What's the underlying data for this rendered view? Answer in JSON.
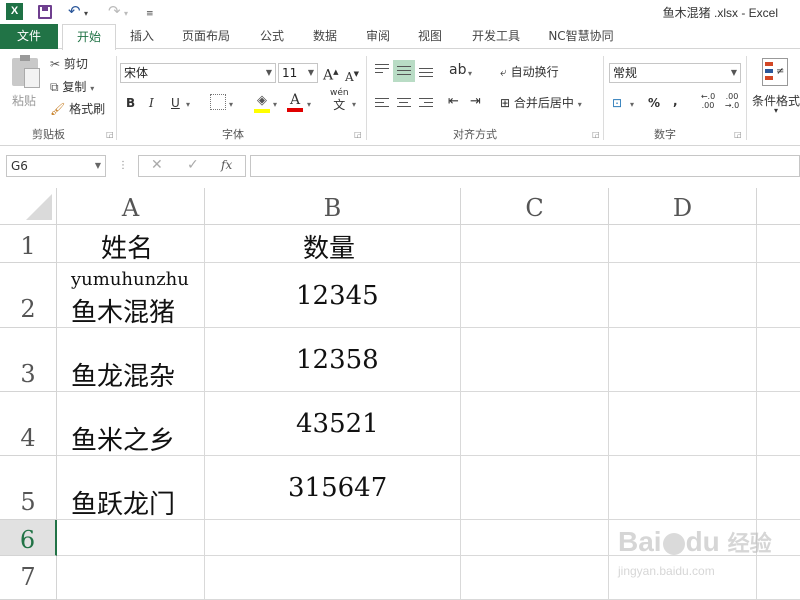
{
  "window": {
    "title": "鱼木混猪 .xlsx - Excel"
  },
  "ribbon": {
    "tabs": [
      "文件",
      "开始",
      "插入",
      "页面布局",
      "公式",
      "数据",
      "审阅",
      "视图",
      "开发工具",
      "NC智慧协同"
    ],
    "active_tab": "开始",
    "clipboard": {
      "paste": "粘贴",
      "cut": "剪切",
      "copy": "复制",
      "format_painter": "格式刷",
      "group": "剪贴板"
    },
    "font": {
      "name": "宋体",
      "size": "11",
      "group": "字体",
      "bold": "B",
      "italic": "I",
      "underline": "U",
      "wen": "wén",
      "wen_char": "文"
    },
    "alignment": {
      "wrap": "自动换行",
      "merge": "合并后居中",
      "group": "对齐方式"
    },
    "number": {
      "format": "常规",
      "percent": "%",
      "comma": ",",
      "inc": "←.0 .00",
      "dec": ".00 →.0",
      "group": "数字"
    },
    "styles": {
      "conditional": "条件格式"
    }
  },
  "formula_bar": {
    "name_box": "G6",
    "fx": "fx",
    "value": ""
  },
  "columns": [
    "A",
    "B",
    "C",
    "D"
  ],
  "rows": [
    {
      "num": "1",
      "a": "姓名",
      "b": "数量",
      "phonetic": ""
    },
    {
      "num": "2",
      "a": "鱼木混猪",
      "b": "12345",
      "phonetic": "yumuhunzhu"
    },
    {
      "num": "3",
      "a": "鱼龙混杂",
      "b": "12358",
      "phonetic": ""
    },
    {
      "num": "4",
      "a": "鱼米之乡",
      "b": "43521",
      "phonetic": ""
    },
    {
      "num": "5",
      "a": "鱼跃龙门",
      "b": "315647",
      "phonetic": ""
    },
    {
      "num": "6",
      "a": "",
      "b": "",
      "phonetic": ""
    },
    {
      "num": "7",
      "a": "",
      "b": "",
      "phonetic": ""
    }
  ],
  "selected_cell": "G6",
  "watermark": {
    "brand": "Bai",
    "brand2": "du",
    "jingyan": "经验",
    "url": "jingyan.baidu.com"
  },
  "colors": {
    "excel_green": "#217346",
    "selected_row_header": "#217346"
  }
}
